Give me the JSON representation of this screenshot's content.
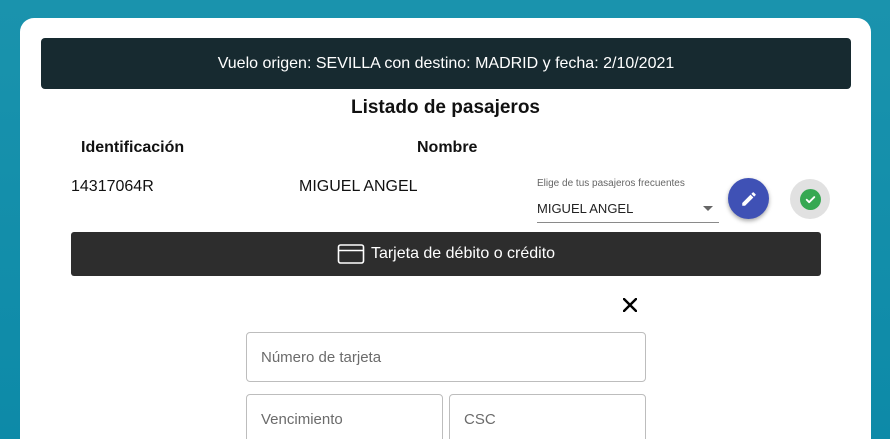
{
  "banner": {
    "text": "Vuelo origen: SEVILLA con destino: MADRID y fecha: 2/10/2021"
  },
  "passengers": {
    "title": "Listado de pasajeros",
    "headers": [
      "Identificación",
      "Nombre"
    ],
    "rows": [
      {
        "id": "14317064R",
        "name": "MIGUEL ANGEL",
        "frequent_label": "Elige de tus pasajeros frecuentes",
        "frequent_selected": "MIGUEL ANGEL"
      }
    ],
    "edit_icon": "pencil-icon",
    "confirm_icon": "check-circle-icon"
  },
  "payment": {
    "method_label": "Tarjeta de débito o crédito",
    "method_icon": "credit-card-icon",
    "close_icon": "close-icon",
    "card_number_placeholder": "Número de tarjeta",
    "expiry_placeholder": "Vencimiento",
    "csc_placeholder": "CSC"
  },
  "colors": {
    "banner_bg": "#172a30",
    "edit_button": "#3f51b5",
    "confirm_check": "#36a852",
    "payment_bar": "#2d2d2d",
    "page_bg": "#1a93ad"
  }
}
